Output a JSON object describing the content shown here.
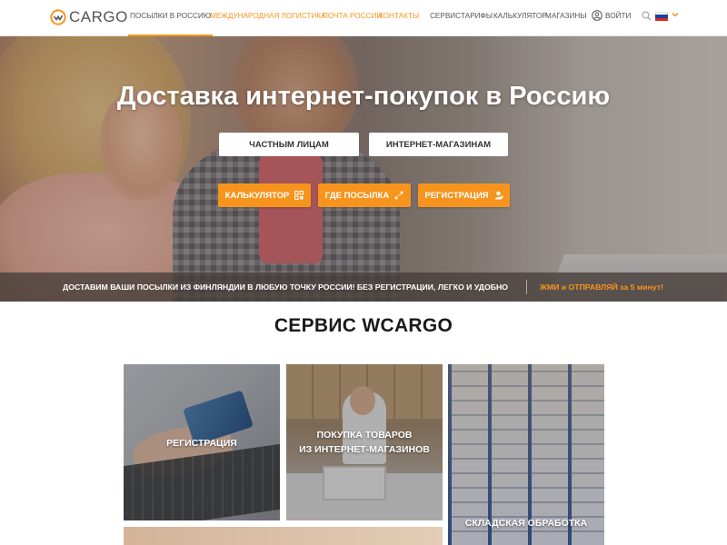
{
  "header": {
    "logo_text": "CARGO",
    "nav": [
      {
        "label": "Посылки в Россию",
        "style": "active"
      },
      {
        "label": "Международная логистика",
        "style": "orange"
      },
      {
        "label": "Почта России",
        "style": "orange"
      },
      {
        "label": "Контакты",
        "style": "orange"
      },
      {
        "label": "Сервис",
        "style": "gray"
      },
      {
        "label": "Тарифы",
        "style": "gray"
      },
      {
        "label": "Калькулятор",
        "style": "gray"
      },
      {
        "label": "Магазины",
        "style": "gray"
      }
    ],
    "login_label": "Войти",
    "icons": {
      "login": "user-circle-icon",
      "search": "search-icon",
      "language": "russia-flag-icon",
      "caret": "chevron-down-icon"
    }
  },
  "hero": {
    "title": "Доставка интернет-покупок в Россию",
    "audience_buttons": [
      "Частным лицам",
      "Интернет-магазинам"
    ],
    "action_buttons": [
      {
        "label": "Калькулятор",
        "icon": "calculator-grid-icon"
      },
      {
        "label": "Где посылка",
        "icon": "route-icon"
      },
      {
        "label": "Регистрация",
        "icon": "user-add-icon"
      }
    ],
    "bar_text": "Доставим ваши посылки из Финляндии в любую точку России! Без регистрации, легко и удобно",
    "bar_cta": "ЖМИ и ОТПРАВЛЯЙ за 5 минут!"
  },
  "services": {
    "title": "СЕРВИС WCARGO",
    "tiles": [
      {
        "lines": [
          "Регистрация"
        ]
      },
      {
        "lines": [
          "Покупка товаров",
          "из интернет-магазинов"
        ]
      },
      {
        "lines": [
          "Складская обработка"
        ]
      }
    ]
  },
  "colors": {
    "accent": "#f7941d",
    "text": "#333333",
    "bar_bg": "#463e3a"
  }
}
